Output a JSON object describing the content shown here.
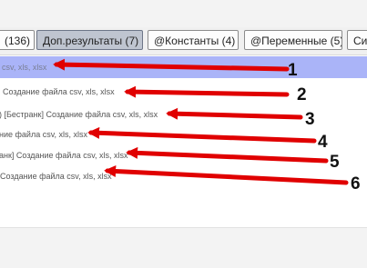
{
  "tabs": [
    {
      "label": "(136)"
    },
    {
      "label": "Доп.результаты (7)"
    },
    {
      "label": "@Константы (4)"
    },
    {
      "label": "@Переменные (5)"
    },
    {
      "label": "Си"
    }
  ],
  "rows": [
    {
      "text": "csv, xls, xlsx"
    },
    {
      "text": "] Создание файла csv, xls, xlsx"
    },
    {
      "text": ") [Бестранк] Создание файла csv, xls, xlsx"
    },
    {
      "text": "ние файла csv, xls, xlsx"
    },
    {
      "text": "анк] Создание файла csv, xls, xlsx"
    },
    {
      "text": "Создание файла csv, xls, xlsx"
    }
  ],
  "annotations": [
    "1",
    "2",
    "3",
    "4",
    "5",
    "6"
  ],
  "colors": {
    "arrow": "#e00000",
    "selected_row": "#aab4f8",
    "active_tab": "#bfc5d0"
  }
}
